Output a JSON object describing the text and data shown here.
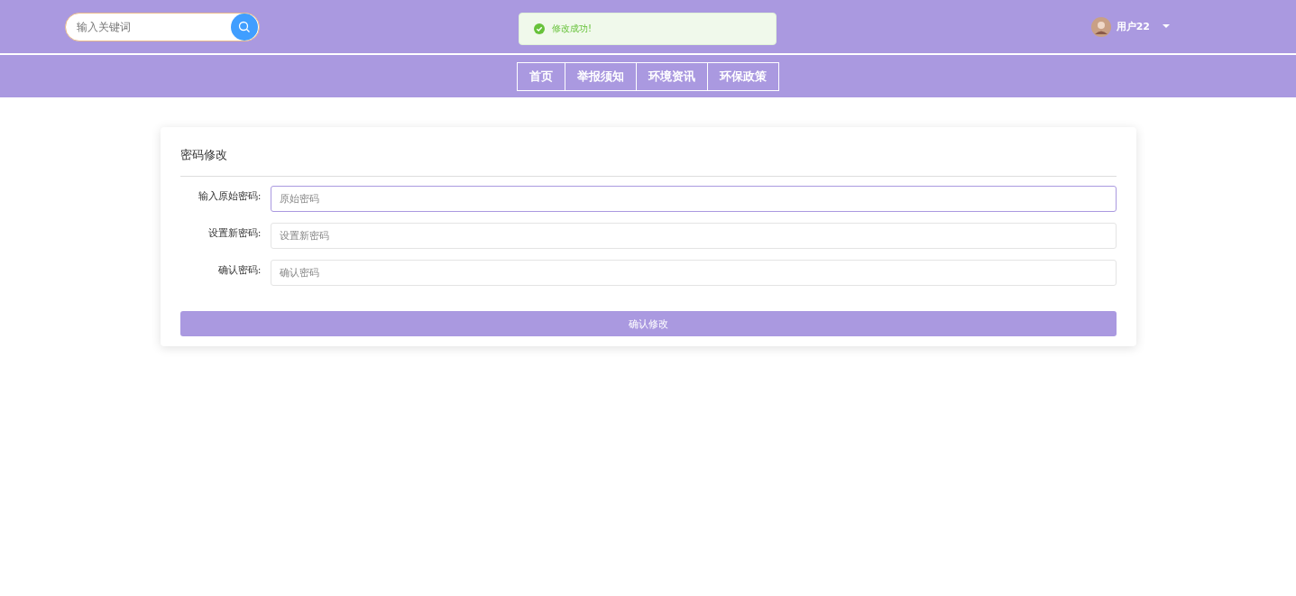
{
  "header": {
    "search": {
      "placeholder": "输入关键词"
    },
    "user": {
      "name": "用户22"
    }
  },
  "toast": {
    "message": "修改成功!"
  },
  "nav": [
    {
      "label": "首页"
    },
    {
      "label": "举报须知"
    },
    {
      "label": "环境资讯"
    },
    {
      "label": "环保政策"
    }
  ],
  "form": {
    "title": "密码修改",
    "fields": [
      {
        "label": "输入原始密码:",
        "placeholder": "原始密码",
        "focused": true
      },
      {
        "label": "设置新密码:",
        "placeholder": "设置新密码",
        "focused": false
      },
      {
        "label": "确认密码:",
        "placeholder": "确认密码",
        "focused": false
      }
    ],
    "submit": "确认修改"
  }
}
